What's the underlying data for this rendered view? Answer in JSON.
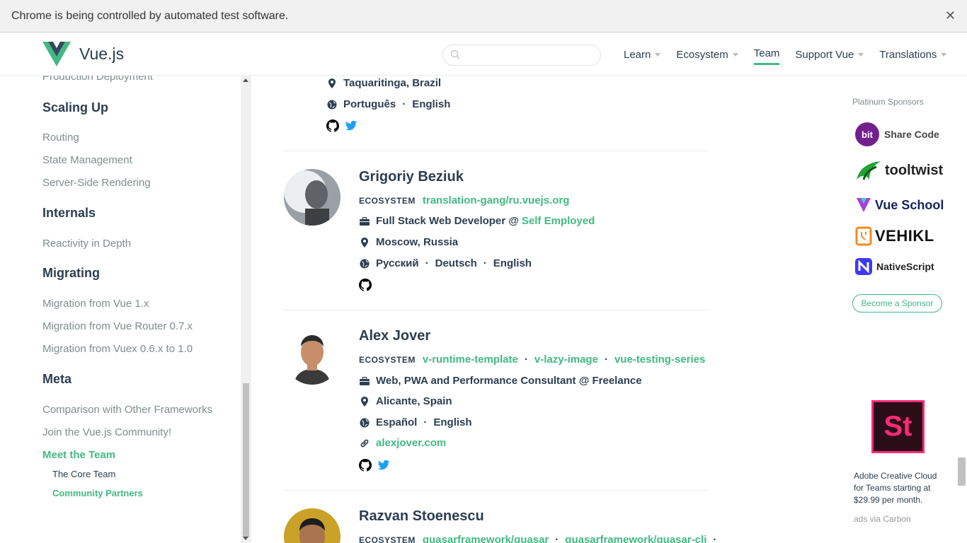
{
  "infobar": {
    "message": "Chrome is being controlled by automated test software.",
    "close": "✕"
  },
  "header": {
    "logo_text": "Vue.js",
    "search_placeholder": "",
    "nav": [
      {
        "label": "Learn",
        "has_caret": true
      },
      {
        "label": "Ecosystem",
        "has_caret": true
      },
      {
        "label": "Team",
        "has_caret": false,
        "active": true
      },
      {
        "label": "Support Vue",
        "has_caret": true
      },
      {
        "label": "Translations",
        "has_caret": true
      }
    ]
  },
  "sidebar": {
    "partial_top": "Production Deployment",
    "sections": {
      "scaling_up": "Scaling Up",
      "internals": "Internals",
      "migrating": "Migrating",
      "meta": "Meta"
    },
    "links": {
      "routing": "Routing",
      "state_management": "State Management",
      "ssr": "Server-Side Rendering",
      "reactivity": "Reactivity in Depth",
      "migration_vue1": "Migration from Vue 1.x",
      "migration_router": "Migration from Vue Router 0.7.x",
      "migration_vuex": "Migration from Vuex 0.6.x to 1.0",
      "comparison": "Comparison with Other Frameworks",
      "join": "Join the Vue.js Community!",
      "meet_team": "Meet the Team",
      "core_team": "The Core Team",
      "community_partners": "Community Partners"
    }
  },
  "members": {
    "partial": {
      "location": "Taquaritinga, Brazil",
      "languages": [
        "Português",
        "English"
      ]
    },
    "grigoriy": {
      "name": "Grigoriy Beziuk",
      "ecosystem_label": "ECOSYSTEM",
      "ecosystem": [
        "translation-gang/ru.vuejs.org"
      ],
      "work_prefix": "Full Stack Web Developer @ ",
      "work_company": "Self Employed",
      "location": "Moscow, Russia",
      "languages": [
        "Русский",
        "Deutsch",
        "English"
      ]
    },
    "alex": {
      "name": "Alex Jover",
      "ecosystem_label": "ECOSYSTEM",
      "ecosystem": [
        "v-runtime-template",
        "v-lazy-image",
        "vue-testing-series"
      ],
      "work": "Web, PWA and Performance Consultant @ Freelance",
      "location": "Alicante, Spain",
      "languages": [
        "Español",
        "English"
      ],
      "website": "alexjover.com"
    },
    "razvan": {
      "name": "Razvan Stoenescu",
      "ecosystem_label": "ECOSYSTEM",
      "ecosystem": [
        "quasarframework/quasar",
        "quasarframework/quasar-cli"
      ]
    }
  },
  "ads": {
    "platinum_title": "Platinum Sponsors",
    "sponsors": [
      "Share Code",
      "tooltwist",
      "Vue School",
      "VEHIKL",
      "NativeScript"
    ],
    "bit_logo": "bit",
    "become_sponsor": "Become a Sponsor",
    "carbon_glyph": "St",
    "carbon_text": "Adobe Creative Cloud for Teams starting at $29.99 per month.",
    "carbon_via": "ads via Carbon"
  },
  "colors": {
    "accent": "#42b983",
    "text": "#2c3e50",
    "muted": "#7f8c8d",
    "twitter": "#1da1f2"
  }
}
